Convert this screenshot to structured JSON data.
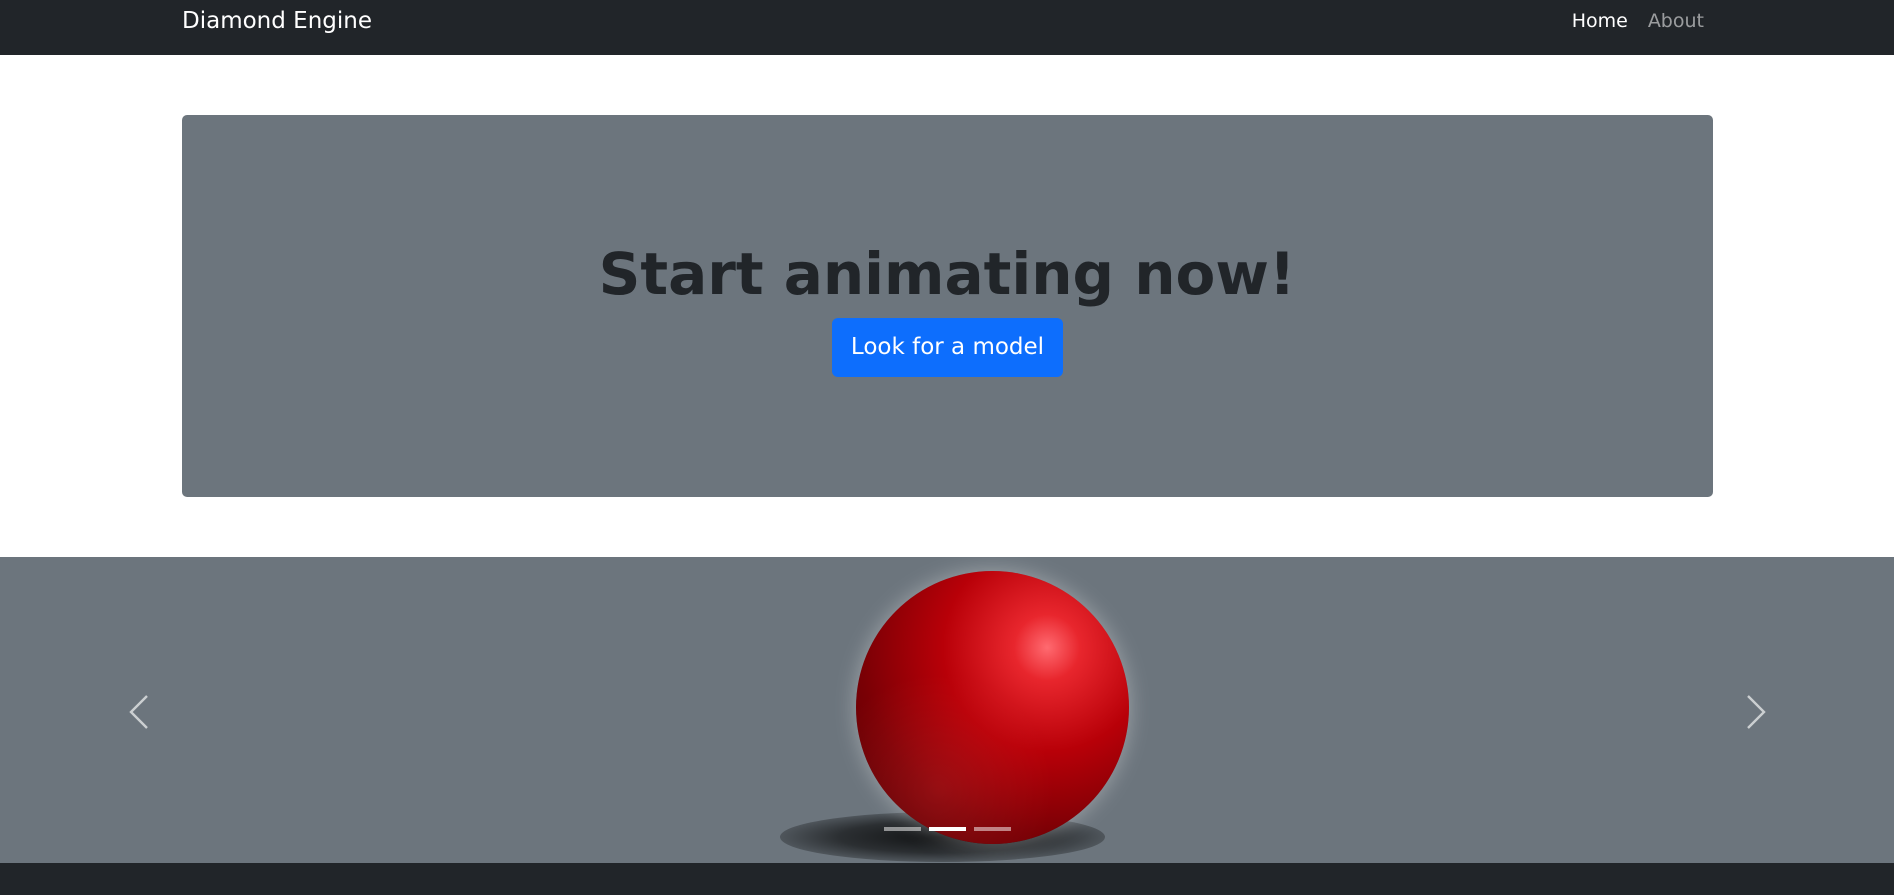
{
  "navbar": {
    "brand": "Diamond Engine",
    "links": [
      {
        "label": "Home",
        "active": true
      },
      {
        "label": "About",
        "active": false
      }
    ]
  },
  "hero": {
    "title": "Start animating now!",
    "button_label": "Look for a model"
  },
  "carousel": {
    "slide_image": "red-sphere",
    "slide_count": 3,
    "active_index": 1,
    "prev_icon": "chevron-left-icon",
    "next_icon": "chevron-right-icon"
  },
  "colors": {
    "navbar_bg": "#212529",
    "hero_bg": "#6c757d",
    "primary_button": "#0d6efd",
    "footer_bg": "#212529"
  }
}
